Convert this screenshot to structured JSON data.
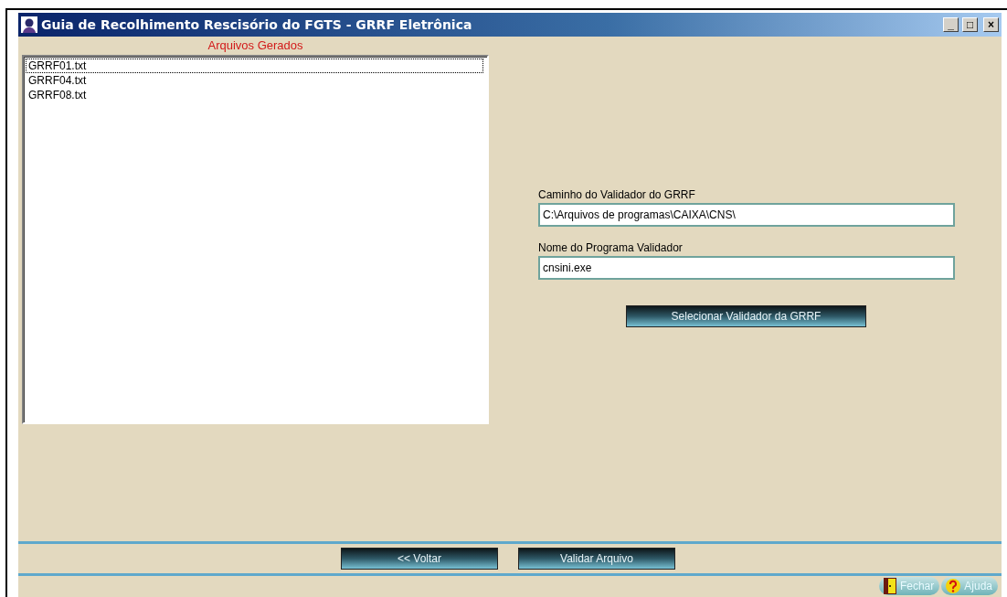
{
  "window": {
    "title": "Guia de Recolhimento Rescisório do FGTS - GRRF Eletrônica",
    "controls": [
      "_",
      "□",
      "×"
    ]
  },
  "files": {
    "title": "Arquivos Gerados",
    "items": [
      {
        "label": "GRRF01.txt",
        "selected": true
      },
      {
        "label": "GRRF04.txt",
        "selected": false
      },
      {
        "label": "GRRF08.txt",
        "selected": false
      }
    ]
  },
  "fields": [
    {
      "label": "Caminho do Validador do GRRF",
      "value": "C:\\Arquivos de programas\\CAIXA\\CNS\\"
    },
    {
      "label": "Nome do Programa Validador",
      "value": "cnsini.exe"
    }
  ],
  "select_button": "Selecionar Validador da GRRF",
  "actions": [
    "<< Voltar",
    "Validar Arquivo"
  ],
  "footer_buttons": [
    {
      "label": "Fechar",
      "kind": "exit"
    },
    {
      "label": "Ajuda",
      "kind": "help"
    }
  ]
}
